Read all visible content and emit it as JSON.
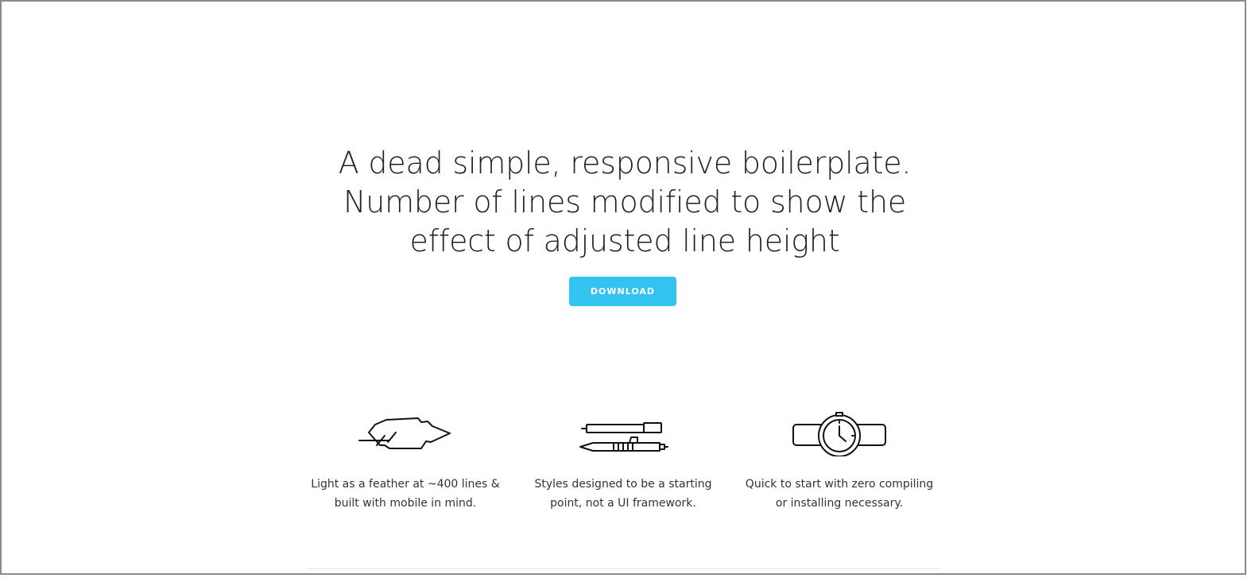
{
  "hero": {
    "title_lines": [
      "A dead simple, responsive boilerplate.",
      "Number of lines modified to show the",
      "effect of adjusted line height"
    ],
    "download_label": "DOWNLOAD"
  },
  "features": [
    {
      "icon": "feather-icon",
      "line1": "Light as a feather at ~400 lines &",
      "line2": "built with mobile in mind."
    },
    {
      "icon": "pens-icon",
      "line1": "Styles designed to be a starting",
      "line2": "point, not a UI framework."
    },
    {
      "icon": "watch-icon",
      "line1": "Quick to start with zero compiling",
      "line2": "or installing necessary."
    }
  ],
  "colors": {
    "accent": "#33c3f0",
    "text": "#222222",
    "border": "#8a8a8a"
  }
}
